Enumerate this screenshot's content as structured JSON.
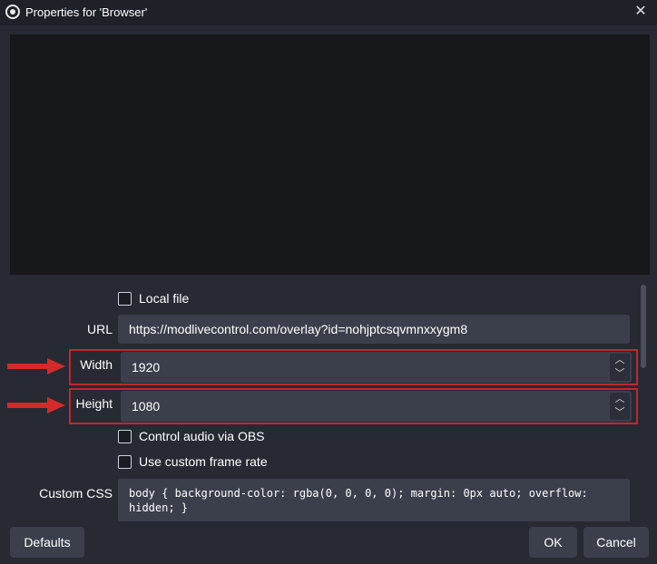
{
  "window": {
    "title": "Properties for 'Browser'",
    "app_icon": "obs-logo-icon",
    "close_icon": "close-icon",
    "close_glyph": "✕"
  },
  "form": {
    "local_file_label": "Local file",
    "url_label": "URL",
    "url_value": "https://modlivecontrol.com/overlay?id=nohjptcsqvmnxxygm8",
    "width_label": "Width",
    "width_value": "1920",
    "height_label": "Height",
    "height_value": "1080",
    "control_audio_label": "Control audio via OBS",
    "custom_frame_rate_label": "Use custom frame rate",
    "custom_css_label": "Custom CSS",
    "custom_css_value": "body { background-color: rgba(0, 0, 0, 0); margin: 0px auto; overflow: hidden; }",
    "spin_up_glyph": "︿",
    "spin_down_glyph": "﹀"
  },
  "buttons": {
    "defaults": "Defaults",
    "ok": "OK",
    "cancel": "Cancel"
  },
  "colors": {
    "background": "#272a33",
    "preview": "#17181c",
    "input": "#3b3f4c",
    "highlight": "#c0282d",
    "arrow": "#d42a2a"
  }
}
